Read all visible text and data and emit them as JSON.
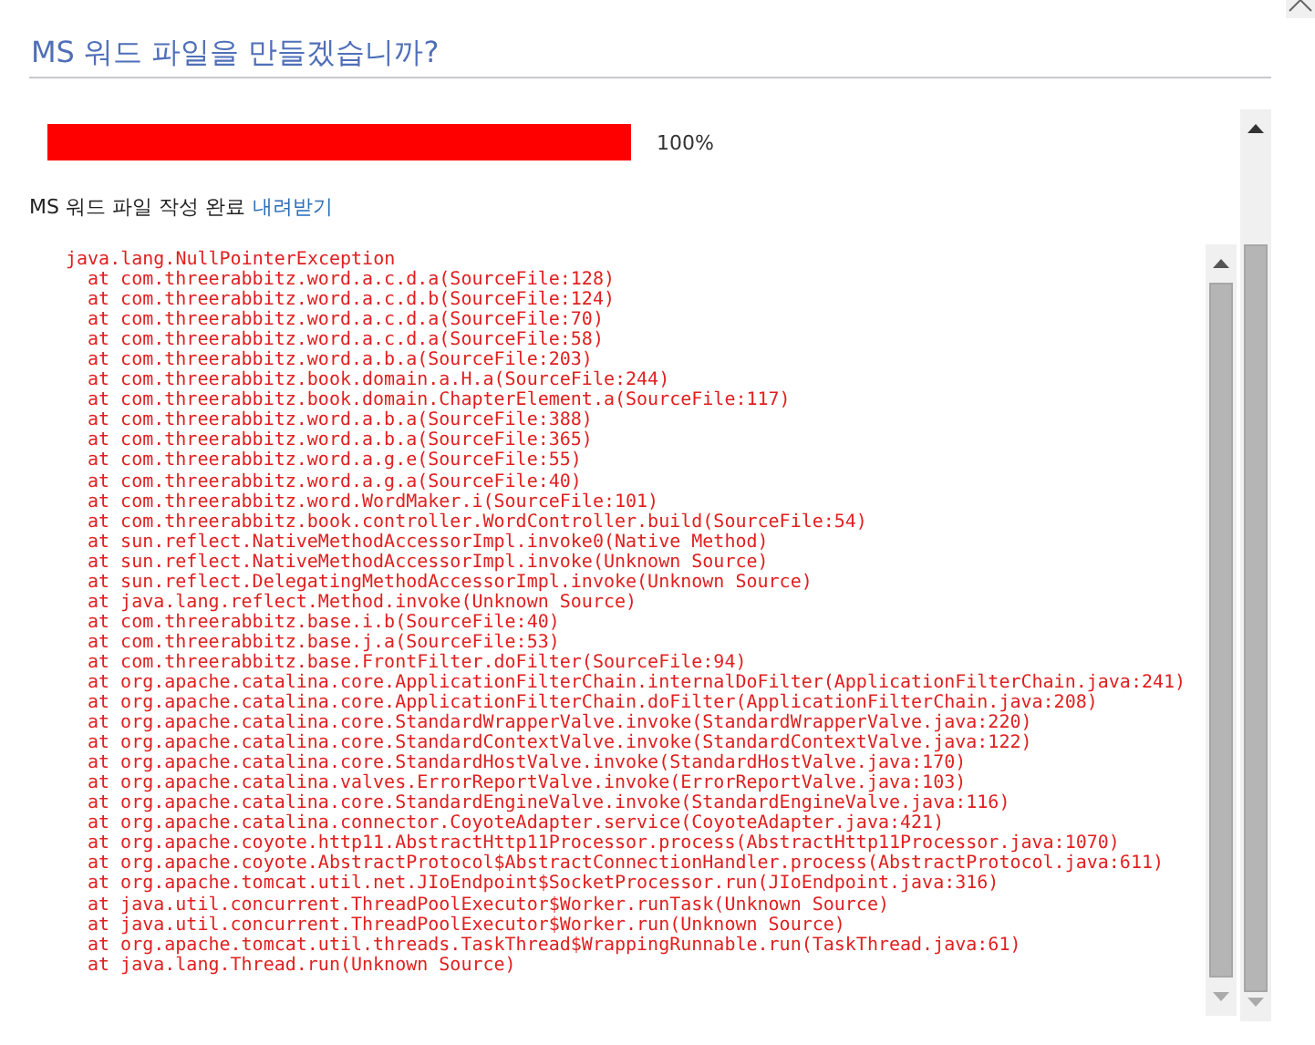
{
  "dialog": {
    "title": "MS 워드 파일을 만들겠습니까?"
  },
  "progress": {
    "level": 1,
    "reading": "100%"
  },
  "status": {
    "text": "MS 워드 파일 작성 완료",
    "link": "내려받기"
  },
  "trace": {
    "exception": "java.lang.NullPointerException",
    "frames": [
      "at com.threerabbitz.word.a.c.d.a(SourceFile:128)",
      "at com.threerabbitz.word.a.c.d.b(SourceFile:124)",
      "at com.threerabbitz.word.a.c.d.a(SourceFile:70)",
      "at com.threerabbitz.word.a.c.d.a(SourceFile:58)",
      "at com.threerabbitz.word.a.b.a(SourceFile:203)",
      "at com.threerabbitz.book.domain.a.H.a(SourceFile:244)",
      "at com.threerabbitz.book.domain.ChapterElement.a(SourceFile:117)",
      "at com.threerabbitz.word.a.b.a(SourceFile:388)",
      "at com.threerabbitz.word.a.b.a(SourceFile:365)",
      "at com.threerabbitz.word.a.g.e(SourceFile:55)",
      "at com.threerabbitz.word.a.g.a(SourceFile:40)",
      "at com.threerabbitz.word.WordMaker.i(SourceFile:101)",
      "at com.threerabbitz.book.controller.WordController.build(SourceFile:54)",
      "at sun.reflect.NativeMethodAccessorImpl.invoke0(Native Method)",
      "at sun.reflect.NativeMethodAccessorImpl.invoke(Unknown Source)",
      "at sun.reflect.DelegatingMethodAccessorImpl.invoke(Unknown Source)",
      "at java.lang.reflect.Method.invoke(Unknown Source)",
      "at com.threerabbitz.base.i.b(SourceFile:40)",
      "at com.threerabbitz.base.j.a(SourceFile:53)",
      "at com.threerabbitz.base.FrontFilter.doFilter(SourceFile:94)",
      "at org.apache.catalina.core.ApplicationFilterChain.internalDoFilter(ApplicationFilterChain.java:241)",
      "at org.apache.catalina.core.ApplicationFilterChain.doFilter(ApplicationFilterChain.java:208)",
      "at org.apache.catalina.core.StandardWrapperValve.invoke(StandardWrapperValve.java:220)",
      "at org.apache.catalina.core.StandardContextValve.invoke(StandardContextValve.java:122)",
      "at org.apache.catalina.core.StandardHostValve.invoke(StandardHostValve.java:170)",
      "at org.apache.catalina.valves.ErrorReportValve.invoke(ErrorReportValve.java:103)",
      "at org.apache.catalina.core.StandardEngineValve.invoke(StandardEngineValve.java:116)",
      "at org.apache.catalina.connector.CoyoteAdapter.service(CoyoteAdapter.java:421)",
      "at org.apache.coyote.http11.AbstractHttp11Processor.process(AbstractHttp11Processor.java:1070)",
      "at org.apache.coyote.AbstractProtocol$AbstractConnectionHandler.process(AbstractProtocol.java:611)",
      "at org.apache.tomcat.util.net.JIoEndpoint$SocketProcessor.run(JIoEndpoint.java:316)",
      "at java.util.concurrent.ThreadPoolExecutor$Worker.runTask(Unknown Source)",
      "at java.util.concurrent.ThreadPoolExecutor$Worker.run(Unknown Source)",
      "at org.apache.tomcat.util.threads.TaskThread$WrappingRunnable.run(TaskThread.java:61)",
      "at java.lang.Thread.run(Unknown Source)"
    ]
  }
}
